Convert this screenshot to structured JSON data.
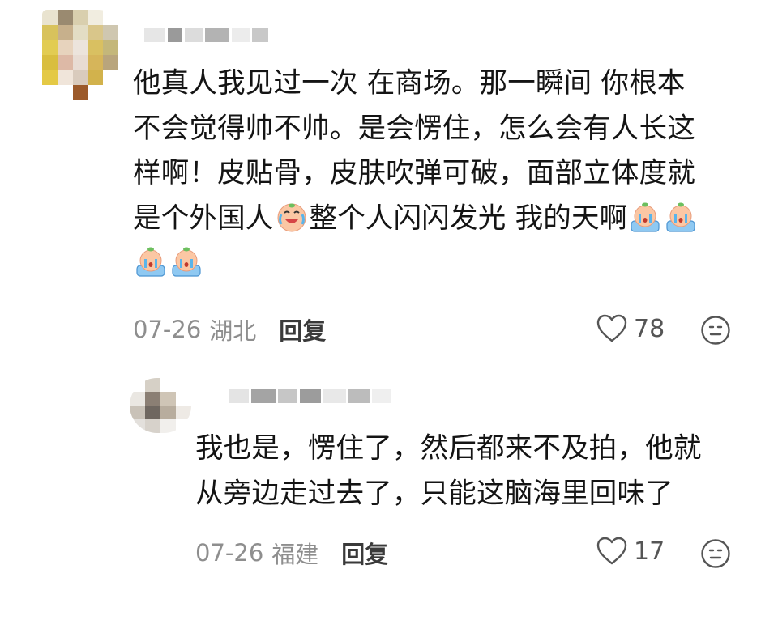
{
  "comments": [
    {
      "text_lines": [
        "他真人我见过一次  在商场。那一瞬间 你根本",
        "不会觉得帅不帅。是会愣住，怎么会有人长这",
        "样啊！皮贴骨，皮肤吹弹可破，面部立体度就"
      ],
      "line4_part1": "是个外国人",
      "line4_part2": "整个人闪闪发光  我的天啊",
      "date": "07-26",
      "location": "湖北",
      "reply_label": "回复",
      "likes": "78",
      "icons": {
        "laugh_cry_emoji": "laugh-cry-emoji",
        "crying_emoji": "crying-emoji",
        "like": "heart-icon",
        "react": "emoji-reaction-icon"
      }
    },
    {
      "text_lines": [
        "我也是，愣住了，然后都来不及拍，他就",
        "从旁边走过去了，只能这脑海里回味了"
      ],
      "date": "07-26",
      "location": "福建",
      "reply_label": "回复",
      "likes": "17"
    }
  ],
  "colors": {
    "text": "#141414",
    "meta": "#8e8e8e",
    "reply_button": "#3a3a3a",
    "icon": "#555555"
  }
}
